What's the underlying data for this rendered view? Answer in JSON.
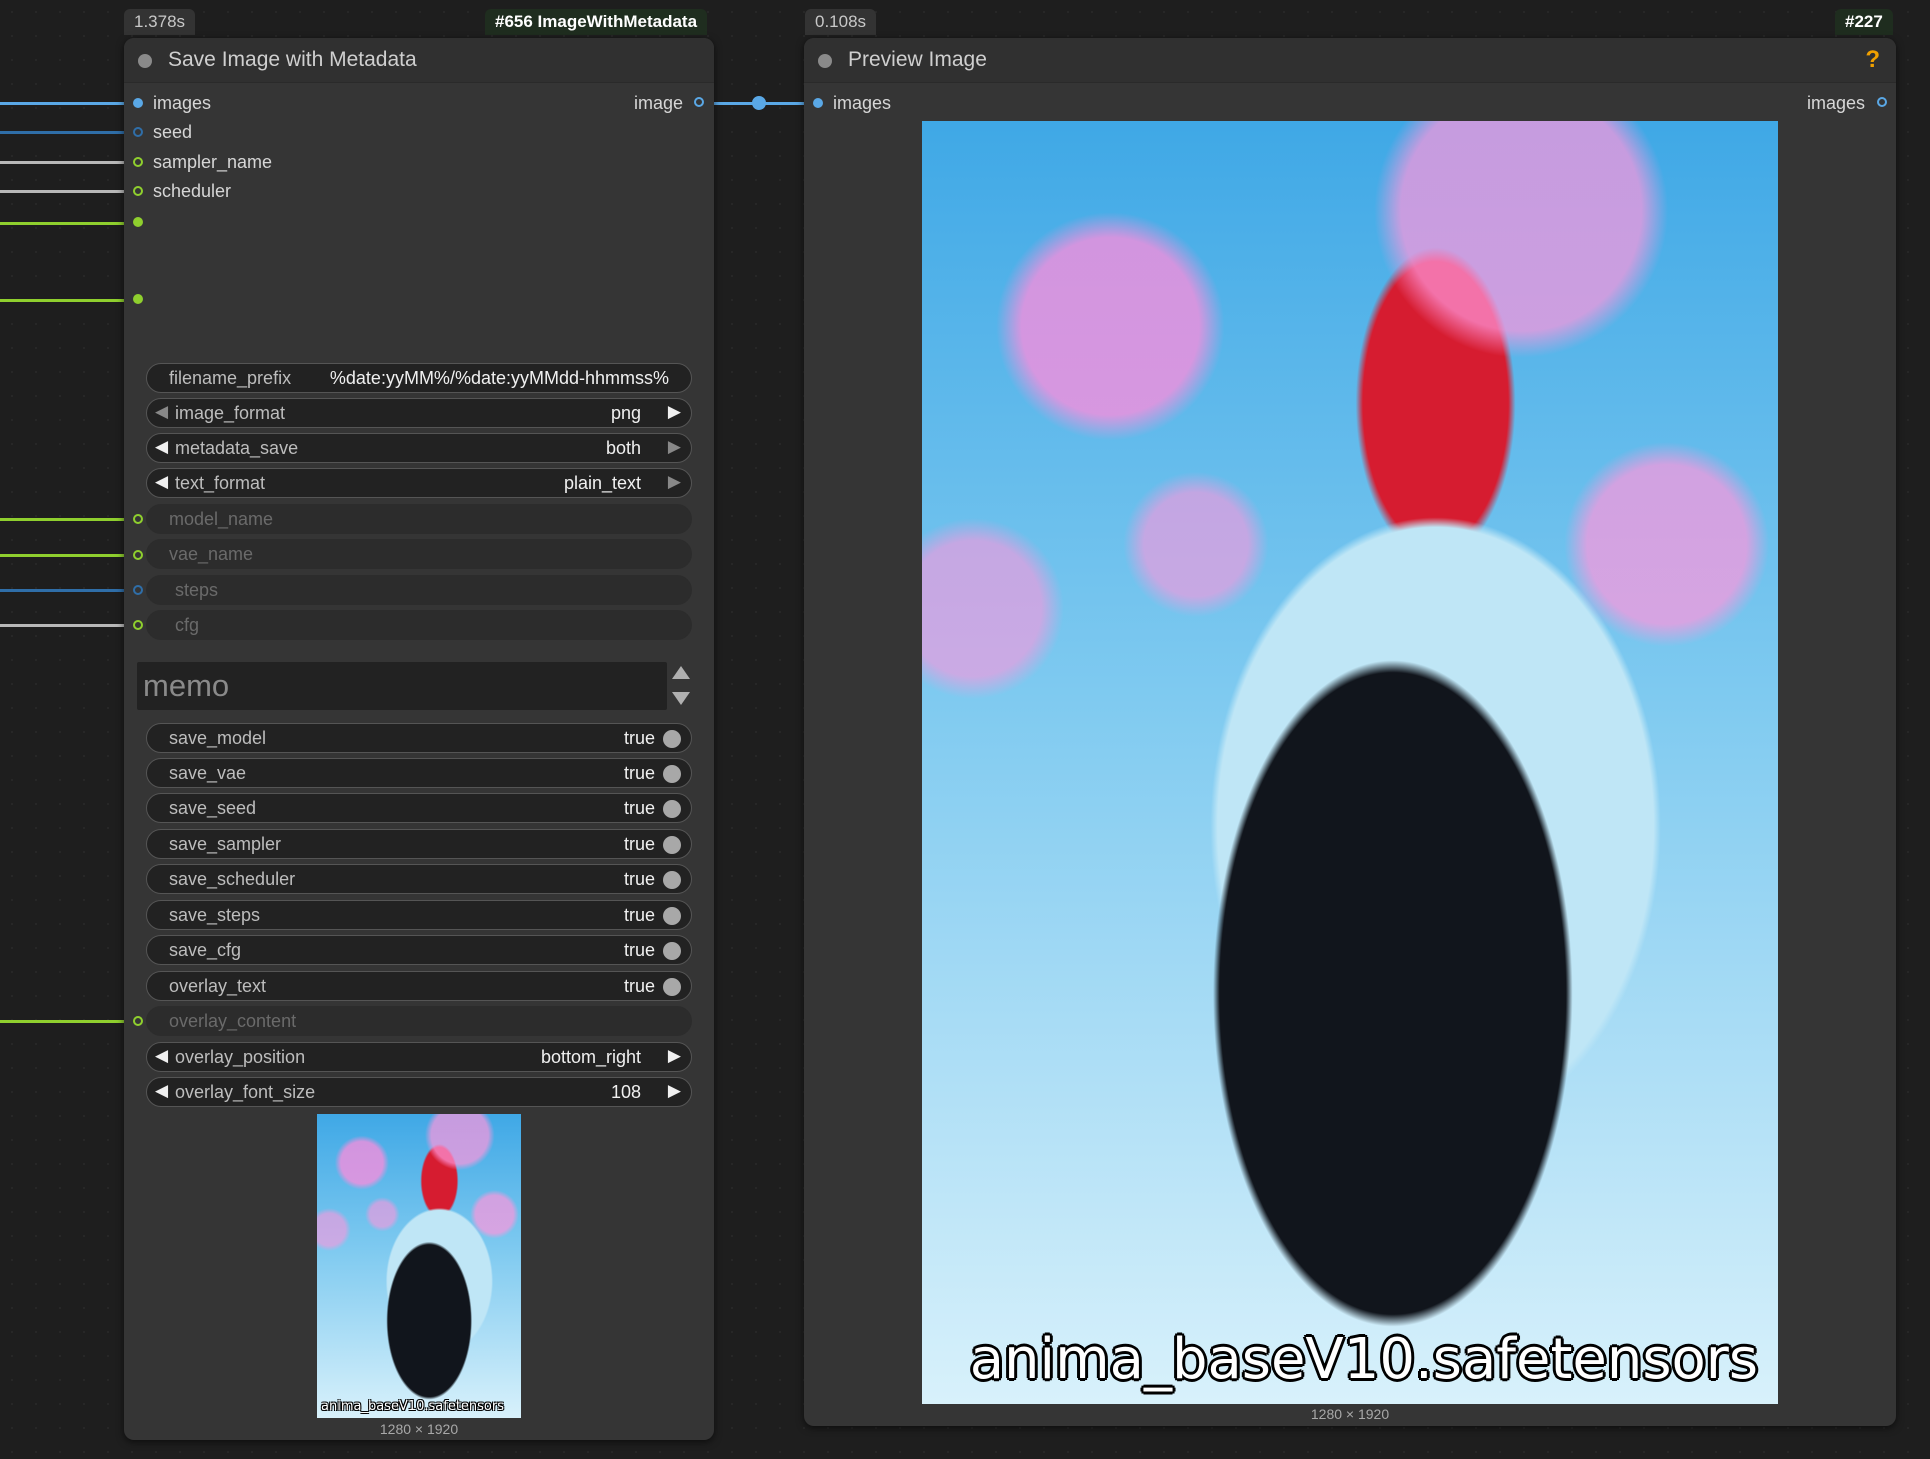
{
  "left_node": {
    "time_badge": "1.378s",
    "id_badge": "#656 ImageWithMetadata",
    "title": "Save Image with Metadata",
    "inputs": [
      "images",
      "seed",
      "sampler_name",
      "scheduler"
    ],
    "output": "image",
    "widgets": {
      "filename_prefix": {
        "label": "filename_prefix",
        "value": "%date:yyMM%/%date:yyMMdd-hhmmss%"
      },
      "image_format": {
        "label": "image_format",
        "value": "png"
      },
      "metadata_save": {
        "label": "metadata_save",
        "value": "both"
      },
      "text_format": {
        "label": "text_format",
        "value": "plain_text"
      },
      "model_name": {
        "label": "model_name"
      },
      "vae_name": {
        "label": "vae_name"
      },
      "steps": {
        "label": "steps"
      },
      "cfg": {
        "label": "cfg"
      },
      "memo_placeholder": "memo",
      "save_model": {
        "label": "save_model",
        "value": "true"
      },
      "save_vae": {
        "label": "save_vae",
        "value": "true"
      },
      "save_seed": {
        "label": "save_seed",
        "value": "true"
      },
      "save_sampler": {
        "label": "save_sampler",
        "value": "true"
      },
      "save_scheduler": {
        "label": "save_scheduler",
        "value": "true"
      },
      "save_steps": {
        "label": "save_steps",
        "value": "true"
      },
      "save_cfg": {
        "label": "save_cfg",
        "value": "true"
      },
      "overlay_text": {
        "label": "overlay_text",
        "value": "true"
      },
      "overlay_content": {
        "label": "overlay_content"
      },
      "overlay_position": {
        "label": "overlay_position",
        "value": "bottom_right"
      },
      "overlay_font_size": {
        "label": "overlay_font_size",
        "value": "108"
      }
    },
    "thumbnail_caption": "anima_baseV10.safetensors",
    "thumbnail_dims": "1280 × 1920"
  },
  "right_node": {
    "time_badge": "0.108s",
    "id_badge": "#227",
    "title": "Preview Image",
    "help": "?",
    "input": "images",
    "output": "images",
    "image_caption": "anima_baseV10.safetensors",
    "image_dims": "1280 × 1920"
  },
  "colors": {
    "image_wire": "#5aa8e6",
    "int_wire": "#2f6ea8",
    "string_wire": "#b8b8b8",
    "green_wire": "#8fcf2e",
    "help": "#f0a000"
  }
}
